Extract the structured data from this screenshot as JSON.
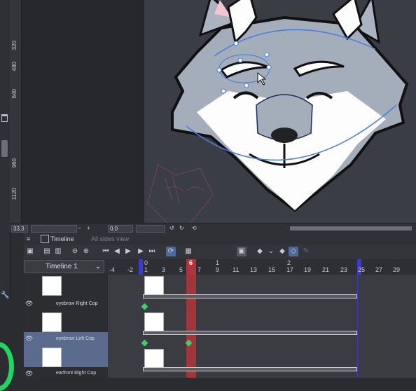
{
  "ruler": {
    "ticks": [
      "320",
      "480",
      "640",
      "960",
      "1120"
    ]
  },
  "status": {
    "zoom": "33.3",
    "minus": "−",
    "plus": "+",
    "angle": "0.0"
  },
  "timeline": {
    "tab_label": "Timeline",
    "tab2_label": "All sides view",
    "select_value": "Timeline 1",
    "frame_numbers": [
      "-4",
      "-2",
      "1",
      "3",
      "5",
      "6",
      "7",
      "9",
      "11",
      "13",
      "15",
      "17",
      "19",
      "21",
      "23",
      "25",
      "27",
      "29"
    ],
    "section_labels": [
      "0",
      "1",
      "2"
    ],
    "current_frame": "6"
  },
  "layers": [
    {
      "name": "",
      "has_eye": false
    },
    {
      "name": "eyebrow Right Cop",
      "has_eye": true
    },
    {
      "name": "",
      "has_eye": false
    },
    {
      "name": "eyebrow Left Cop",
      "has_eye": true
    },
    {
      "name": "",
      "has_eye": false
    },
    {
      "name": "earfront Right Cop",
      "has_eye": true
    }
  ],
  "colors": {
    "accent": "#4b6b9d",
    "playhead": "#b0353a",
    "keyframe": "#3ccf66",
    "range_marker": "#3b3bd0"
  }
}
